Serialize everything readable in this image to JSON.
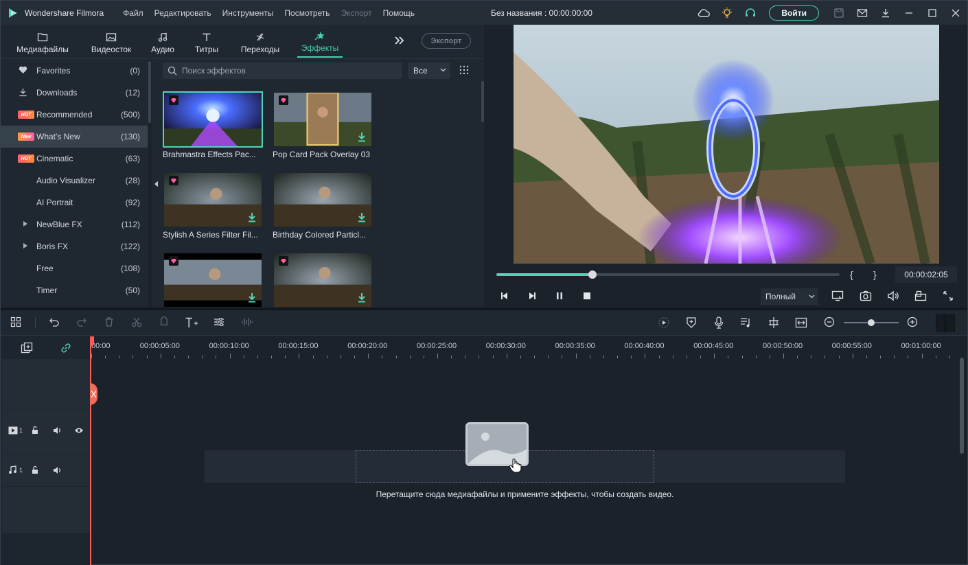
{
  "titlebar": {
    "app_title": "Wondershare Filmora",
    "menu": [
      "Файл",
      "Редактировать",
      "Инструменты",
      "Посмотреть",
      "Экспорт",
      "Помощь"
    ],
    "project_title": "Без названия : 00:00:00:00",
    "login_label": "Войти"
  },
  "tabs": [
    {
      "label": "Медиафайлы",
      "icon": "folder-icon"
    },
    {
      "label": "Видеосток",
      "icon": "stock-image-icon"
    },
    {
      "label": "Аудио",
      "icon": "music-note-icon"
    },
    {
      "label": "Титры",
      "icon": "text-icon"
    },
    {
      "label": "Переходы",
      "icon": "transition-icon"
    },
    {
      "label": "Эффекты",
      "icon": "effects-icon",
      "active": true
    }
  ],
  "export_small": "Экспорт",
  "sidebar": {
    "items": [
      {
        "label": "Favorites",
        "count": "(0)",
        "icon": "heart-icon"
      },
      {
        "label": "Downloads",
        "count": "(12)",
        "icon": "download-icon"
      },
      {
        "label": "Recommended",
        "count": "(500)",
        "badge": "HOT"
      },
      {
        "label": "What's New",
        "count": "(130)",
        "badge": "New",
        "active": true
      },
      {
        "label": "Cinematic",
        "count": "(63)",
        "badge": "HOT"
      },
      {
        "label": "Audio Visualizer",
        "count": "(28)"
      },
      {
        "label": "AI Portrait",
        "count": "(92)"
      },
      {
        "label": "NewBlue FX",
        "count": "(112)",
        "expandable": true
      },
      {
        "label": "Boris FX",
        "count": "(122)",
        "expandable": true
      },
      {
        "label": "Free",
        "count": "(108)"
      },
      {
        "label": "Timer",
        "count": "(50)"
      }
    ]
  },
  "search": {
    "placeholder": "Поиск эффектов"
  },
  "filter": {
    "selected": "Все"
  },
  "effects": [
    {
      "caption": "Brahmastra Effects Pac...",
      "selected": true
    },
    {
      "caption": "Pop Card Pack Overlay 03"
    },
    {
      "caption": "Stylish A Series Filter Fil..."
    },
    {
      "caption": "Birthday Colored Particl..."
    },
    {
      "caption": ""
    },
    {
      "caption": ""
    }
  ],
  "player": {
    "timecode": "00:00:02:05",
    "progress": 0.28,
    "quality": "Полный",
    "brace_open": "{",
    "brace_close": "}"
  },
  "timeline": {
    "ruler": [
      "00:00",
      "00:00:05:00",
      "00:00:10:00",
      "00:00:15:00",
      "00:00:20:00",
      "00:00:25:00",
      "00:00:30:00",
      "00:00:35:00",
      "00:00:40:00",
      "00:00:45:00",
      "00:00:50:00",
      "00:00:55:00",
      "00:01:00:00"
    ],
    "video_track_num": "1",
    "audio_track_num": "1",
    "drop_text": "Перетащите сюда медиафайлы и примените эффекты, чтобы создать видео.",
    "zoom": 0.5
  },
  "colors": {
    "accent": "#52d3b7",
    "playhead": "#ff5a5a",
    "background": "#1b222a",
    "panel": "#1f2730"
  }
}
